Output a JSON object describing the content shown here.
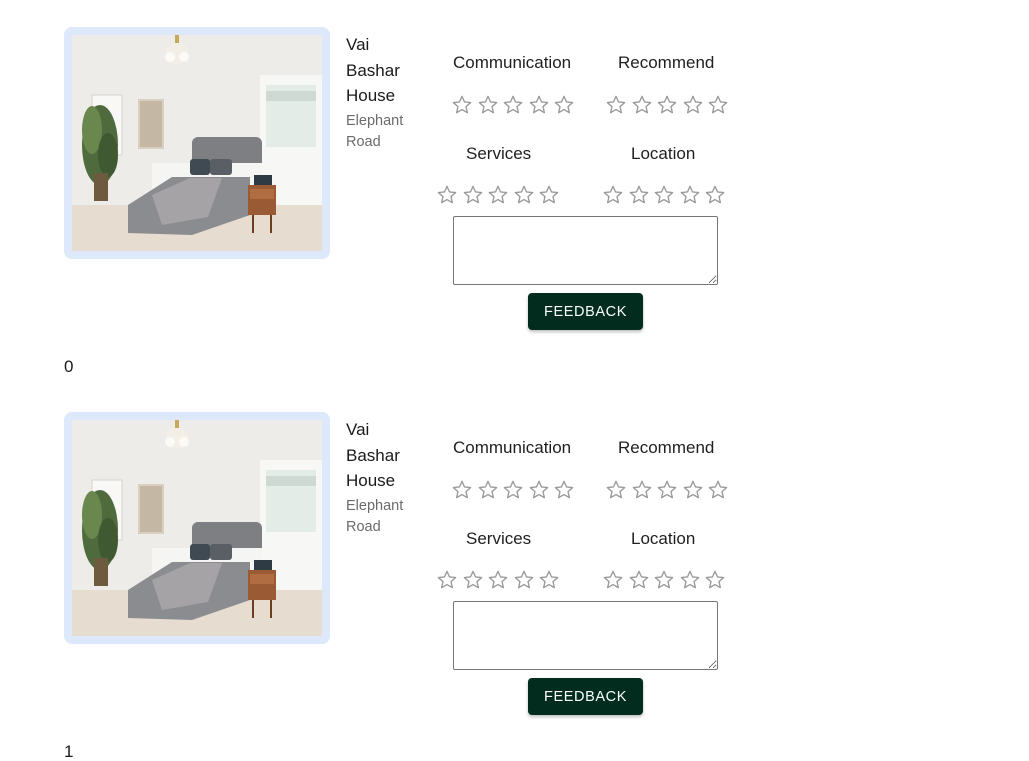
{
  "colors": {
    "image_frame": "#dde9fb",
    "button_bg": "#022c1d",
    "button_text": "#ffffff",
    "star_outline": "#9a9a9a",
    "secondary_text": "#6b6b6b"
  },
  "listings": [
    {
      "index": "0",
      "image": {
        "alt": "bedroom",
        "icon": "bedroom-photo"
      },
      "name": "Vai Bashar House",
      "location": "Elephant Road",
      "ratings": [
        {
          "label": "Communication",
          "value": 0,
          "max": 5
        },
        {
          "label": "Recommend",
          "value": 0,
          "max": 5
        },
        {
          "label": "Services",
          "value": 0,
          "max": 5
        },
        {
          "label": "Location",
          "value": 0,
          "max": 5
        }
      ],
      "feedback_value": "",
      "feedback_button": "FEEDBACK"
    },
    {
      "index": "1",
      "image": {
        "alt": "bedroom",
        "icon": "bedroom-photo"
      },
      "name": "Vai Bashar House",
      "location": "Elephant Road",
      "ratings": [
        {
          "label": "Communication",
          "value": 0,
          "max": 5
        },
        {
          "label": "Recommend",
          "value": 0,
          "max": 5
        },
        {
          "label": "Services",
          "value": 0,
          "max": 5
        },
        {
          "label": "Location",
          "value": 0,
          "max": 5
        }
      ],
      "feedback_value": "",
      "feedback_button": "FEEDBACK"
    }
  ]
}
